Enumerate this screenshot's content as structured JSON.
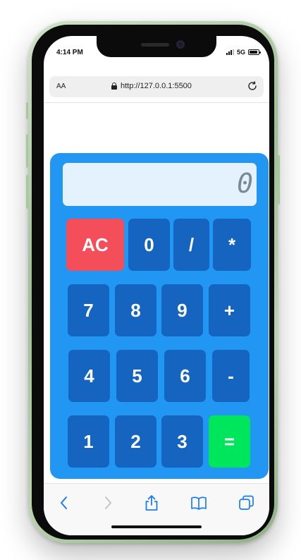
{
  "status": {
    "time": "4:14 PM",
    "network": "5G"
  },
  "browser": {
    "text_size_label": "AA",
    "url": "http://127.0.0.1:5500"
  },
  "calculator": {
    "display_value": "0",
    "keys": {
      "ac": "AC",
      "zero": "0",
      "divide": "/",
      "multiply": "*",
      "seven": "7",
      "eight": "8",
      "nine": "9",
      "plus": "+",
      "four": "4",
      "five": "5",
      "six": "6",
      "minus": "-",
      "one": "1",
      "two": "2",
      "three": "3",
      "equals": "="
    }
  },
  "colors": {
    "calc_body": "#2196f3",
    "key": "#1565c0",
    "ac_key": "#f44e5a",
    "equals_key": "#00e65c",
    "display_bg": "#e3f2fd",
    "phone_frame": "#b9d3ae",
    "toolbar_icon": "#1a7cf5"
  },
  "icons": {
    "lock": "lock-icon",
    "reload": "reload-icon",
    "back": "chevron-left-icon",
    "forward": "chevron-right-icon",
    "share": "share-icon",
    "bookmarks": "book-icon",
    "tabs": "tabs-icon"
  }
}
